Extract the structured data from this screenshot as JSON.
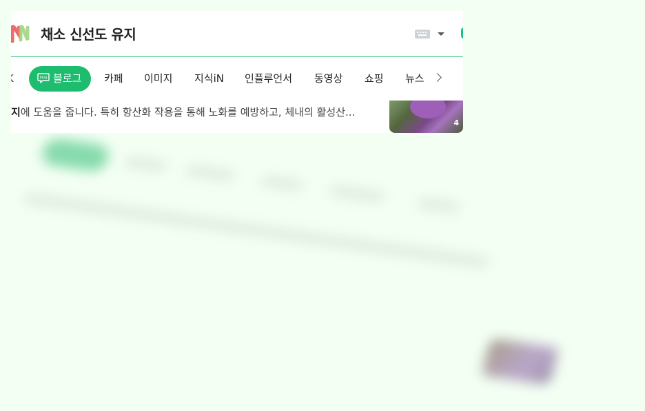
{
  "header": {
    "title": "채소 신선도 유지",
    "keyboard_icon": "keyboard-icon",
    "dropdown_icon": "caret-down-icon"
  },
  "tabs": [
    {
      "label": "K",
      "partial": true
    },
    {
      "label": "블로그",
      "active": true,
      "icon": "blog-icon"
    },
    {
      "label": "카페"
    },
    {
      "label": "이미지"
    },
    {
      "label": "지식iN"
    },
    {
      "label": "인플루언서"
    },
    {
      "label": "동영상"
    },
    {
      "label": "쇼핑"
    },
    {
      "label": "뉴스"
    }
  ],
  "more_icon": "chevron-right-icon",
  "snippet": {
    "bold": "지",
    "text": "에 도움을 줍니다. 특히 항산화 작용을 통해 노화를 예방하고, 체내의 활성산..."
  },
  "thumbnail": {
    "count": "4"
  },
  "colors": {
    "accent": "#1ebc6e",
    "background": "#f3fff3"
  }
}
